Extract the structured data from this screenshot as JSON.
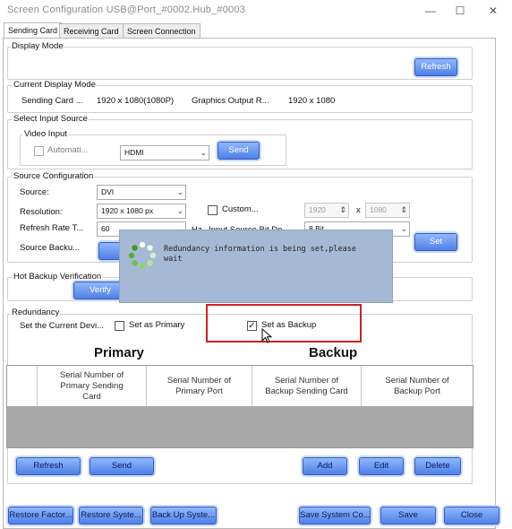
{
  "window": {
    "title": "Screen Configuration USB@Port_#0002.Hub_#0003",
    "minimize_glyph": "—",
    "maximize_glyph": "☐",
    "close_glyph": "✕"
  },
  "tabs": [
    {
      "label": "Sending Card",
      "active": true
    },
    {
      "label": "Receiving Card",
      "active": false
    },
    {
      "label": "Screen Connection",
      "active": false
    }
  ],
  "display_mode": {
    "label": "Display Mode",
    "refresh_button": "Refresh"
  },
  "current_display_mode": {
    "label": "Current Display Mode",
    "sending_card_label": "Sending Card ...",
    "sending_card_value": "1920 x 1080(1080P)",
    "graphics_label": "Graphics Output R...",
    "graphics_value": "1920 x 1080"
  },
  "select_input_source": {
    "label": "Select Input Source",
    "video_input_label": "Video Input",
    "automatic_label": "Automati...",
    "input_value": "HDMI",
    "send_button": "Send"
  },
  "source_configuration": {
    "label": "Source Configuration",
    "source_label": "Source:",
    "source_value": "DVI",
    "resolution_label": "Resolution:",
    "resolution_value": "1920 x 1080 px",
    "custom_label": "Custom...",
    "custom_width": "1920",
    "custom_x": "x",
    "custom_height": "1080",
    "refresh_rate_label": "Refresh Rate T...",
    "refresh_rate_value": "60",
    "hz_label": "Hz",
    "bit_depth_label": "Input Source Bit De...",
    "bit_depth_value": "8 Bit",
    "source_backup_label": "Source Backu...",
    "set_button": "Set"
  },
  "hot_backup": {
    "label": "Hot Backup Verification",
    "verify_button": "Verify"
  },
  "overlay": {
    "message": "Redundancy information is being set,please wait"
  },
  "redundancy": {
    "label": "Redundancy",
    "set_current_label": "Set the Current Devi...",
    "set_primary_label": "Set as Primary",
    "set_backup_label": "Set as Backup",
    "backup_checked": true,
    "primary_heading": "Primary",
    "backup_heading": "Backup",
    "columns": [
      "Serial Number of Primary Sending Card",
      "Serial Number of Primary Port",
      "Serial Number of Backup Sending Card",
      "Serial Number of Backup Port"
    ],
    "refresh_button": "Refresh",
    "send_button": "Send",
    "add_button": "Add",
    "edit_button": "Edit",
    "delete_button": "Delete"
  },
  "footer": {
    "restore_factory": "Restore Factor...",
    "restore_system": "Restore Syste...",
    "back_up_system": "Back Up Syste...",
    "save_system_config": "Save System Co...",
    "save": "Save",
    "close": "Close"
  },
  "colors": {
    "button_blue": "#4f7fe6",
    "overlay": "#a6b9d4",
    "highlight_red": "#d21f1f",
    "table_body": "#a9a9a9"
  }
}
